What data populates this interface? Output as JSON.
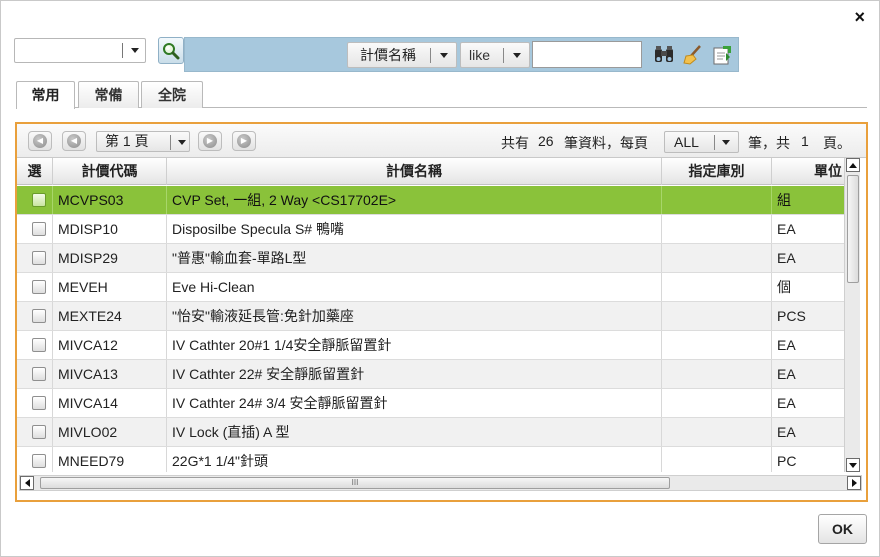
{
  "dialog": {
    "close_label": "×",
    "ok_label": "OK"
  },
  "search": {
    "combo_value": "",
    "field_label": "計價名稱",
    "operator_label": "like",
    "value": ""
  },
  "icons": {
    "search": "magnifier-icon",
    "binoculars": "binoculars-icon",
    "clear": "broom-icon",
    "export": "export-icon"
  },
  "tabs": [
    {
      "label": "常用",
      "active": true
    },
    {
      "label": "常備",
      "active": false
    },
    {
      "label": "全院",
      "active": false
    }
  ],
  "pager": {
    "page_label": "第 1 頁",
    "total_prefix": "共有",
    "total_count": "26",
    "total_suffix": "筆資料，每頁",
    "rows_per_page": "ALL",
    "tail_a": "筆，共",
    "total_pages": "1",
    "tail_b": "頁。"
  },
  "grid": {
    "columns": [
      "選",
      "計價代碼",
      "計價名稱",
      "指定庫別",
      "單位"
    ],
    "rows": [
      {
        "code": "MCVPS03",
        "name": "CVP Set, 一組, 2 Way <CS17702E>",
        "store": "",
        "unit": "組",
        "selected": true
      },
      {
        "code": "MDISP10",
        "name": "Disposilbe Specula S# 鴨嘴",
        "store": "",
        "unit": "EA"
      },
      {
        "code": "MDISP29",
        "name": "\"普惠\"輸血套-單路L型",
        "store": "",
        "unit": "EA"
      },
      {
        "code": "MEVEH",
        "name": "Eve Hi-Clean",
        "store": "",
        "unit": "個"
      },
      {
        "code": "MEXTE24",
        "name": "\"怡安\"輸液延長管:免針加藥座",
        "store": "",
        "unit": "PCS"
      },
      {
        "code": "MIVCA12",
        "name": "IV Cathter 20#1 1/4安全靜脈留置針",
        "store": "",
        "unit": "EA"
      },
      {
        "code": "MIVCA13",
        "name": "IV Cathter 22# 安全靜脈留置針",
        "store": "",
        "unit": "EA"
      },
      {
        "code": "MIVCA14",
        "name": "IV Cathter 24# 3/4 安全靜脈留置針",
        "store": "",
        "unit": "EA"
      },
      {
        "code": "MIVLO02",
        "name": "IV Lock (直插) A 型",
        "store": "",
        "unit": "EA"
      },
      {
        "code": "MNEED79",
        "name": "22G*1 1/4\"針頭",
        "store": "",
        "unit": "PC"
      }
    ]
  },
  "colors": {
    "toolbar_bg": "#a7c8dd",
    "panel_border": "#e9a03c",
    "selected_row": "#8ac23a"
  }
}
